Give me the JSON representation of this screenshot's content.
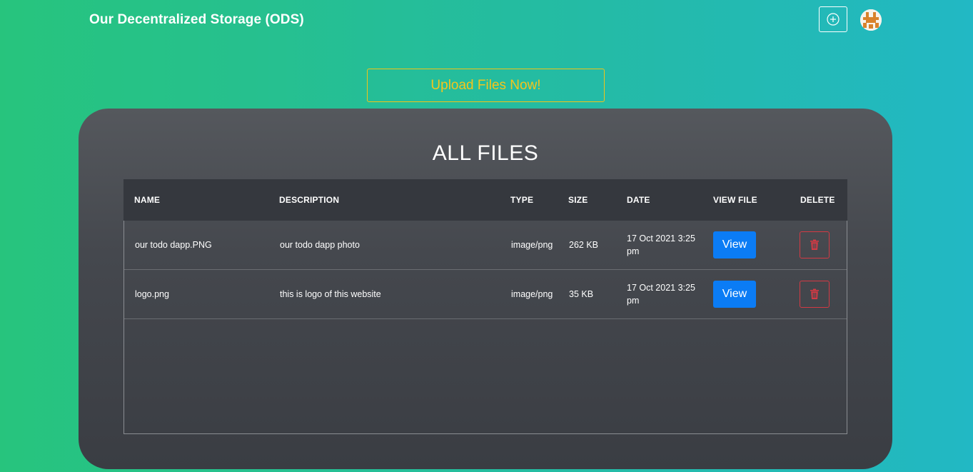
{
  "header": {
    "brand": "Our Decentralized Storage (ODS)",
    "add_icon": "plus-circle-icon",
    "avatar_icon": "identicon-avatar"
  },
  "upload": {
    "label": "Upload Files Now!"
  },
  "files": {
    "title": "ALL FILES",
    "columns": [
      "NAME",
      "DESCRIPTION",
      "TYPE",
      "SIZE",
      "DATE",
      "VIEW FILE",
      "DELETE"
    ],
    "rows": [
      {
        "name": "our todo dapp.PNG",
        "description": "our todo dapp photo",
        "type": "image/png",
        "size": "262 KB",
        "date": "17 Oct 2021 3:25 pm",
        "view_label": "View",
        "delete_icon": "trash-icon"
      },
      {
        "name": "logo.png",
        "description": "this is logo of this website",
        "type": "image/png",
        "size": "35 KB",
        "date": "17 Oct 2021 3:25 pm",
        "view_label": "View",
        "delete_icon": "trash-icon"
      }
    ]
  },
  "colors": {
    "accent_yellow": "#f4c51c",
    "view_blue": "#0b7cf5",
    "delete_red": "#d33a44"
  }
}
